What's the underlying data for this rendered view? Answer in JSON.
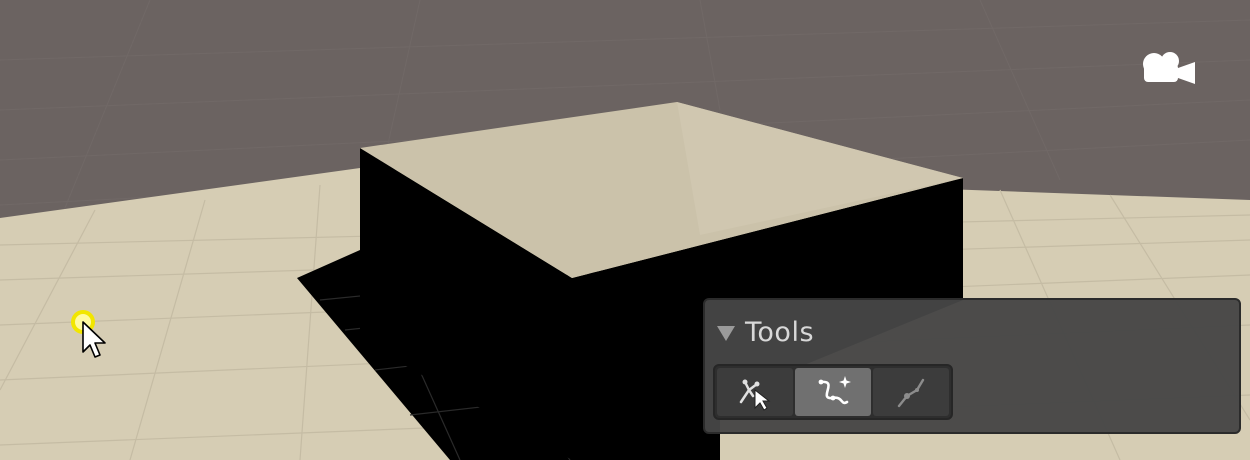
{
  "scene": {
    "name": "scene-view",
    "colors": {
      "sky": "#6b6361",
      "ground": "#d8cfb8",
      "box_top": "#cfc6ae",
      "box_side": "#000000",
      "shadow": "#000000",
      "grid_line": "#bdb5a0"
    }
  },
  "camera_gizmo": {
    "icon": "camera-icon"
  },
  "tools_panel": {
    "title": "Tools",
    "collapse_icon": "triangle-down-icon",
    "tools": [
      {
        "name": "edit-mode-tool",
        "icon": "tree-select-icon",
        "active": false
      },
      {
        "name": "spline-create-tool",
        "icon": "spline-sparkle-icon",
        "active": true
      },
      {
        "name": "knot-edit-tool",
        "icon": "knot-line-icon",
        "active": false
      }
    ]
  },
  "cursor": {
    "icon": "mouse-cursor-icon",
    "highlight_color": "#f2e600"
  }
}
